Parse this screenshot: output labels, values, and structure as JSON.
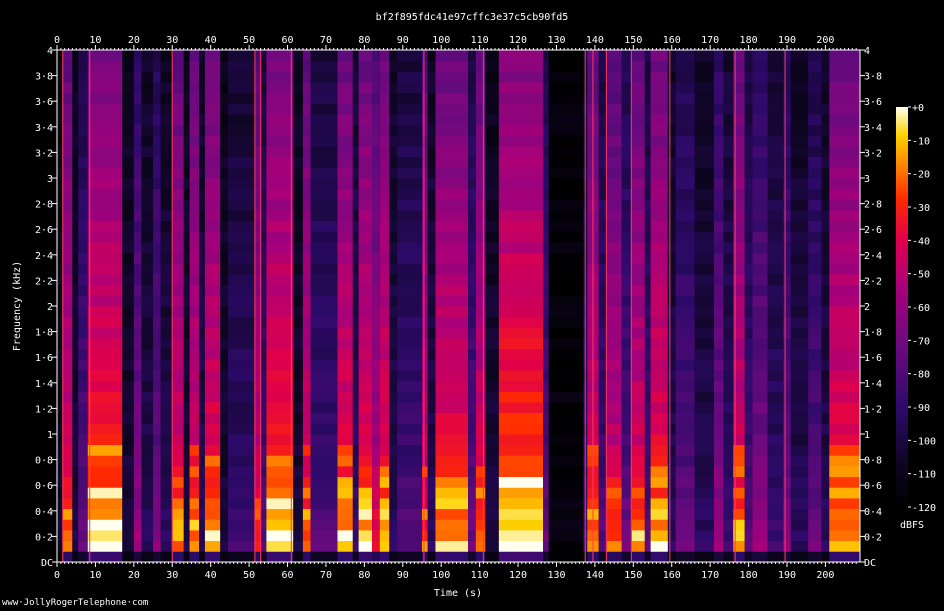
{
  "chart_data": {
    "type": "heatmap",
    "title": "bf2f895fdc41e97cffc3e37c5cb90fd5",
    "xlabel": "Time (s)",
    "ylabel": "Frequency (kHz)",
    "x_ticks": [
      "0",
      "10",
      "20",
      "30",
      "40",
      "50",
      "60",
      "70",
      "80",
      "90",
      "100",
      "110",
      "120",
      "130",
      "140",
      "150",
      "160",
      "170",
      "180",
      "190",
      "200"
    ],
    "y_ticks": [
      "DC",
      "0·2",
      "0·4",
      "0·6",
      "0·8",
      "1",
      "1·2",
      "1·4",
      "1·6",
      "1·8",
      "2",
      "2·2",
      "2·4",
      "2·6",
      "2·8",
      "3",
      "3·2",
      "3·4",
      "3·6",
      "3·8",
      "4"
    ],
    "xlim": [
      0,
      209
    ],
    "ylim": [
      0,
      4
    ],
    "colorbar": {
      "label": "dBFS",
      "ticks": [
        "+0",
        "-10",
        "-20",
        "-30",
        "-40",
        "-50",
        "-60",
        "-70",
        "-80",
        "-90",
        "-100",
        "-110",
        "-120"
      ],
      "range": [
        -120,
        0
      ]
    },
    "intensity_profile": [
      {
        "t0": 0,
        "t1": 1.5,
        "level": 0.1
      },
      {
        "t0": 1.5,
        "t1": 4,
        "level": 0.7
      },
      {
        "t0": 4,
        "t1": 5.5,
        "level": 0.15
      },
      {
        "t0": 5.5,
        "t1": 8,
        "level": 0.35
      },
      {
        "t0": 8,
        "t1": 17,
        "level": 0.8
      },
      {
        "t0": 17,
        "t1": 20,
        "level": 0.15
      },
      {
        "t0": 20,
        "t1": 22,
        "level": 0.45
      },
      {
        "t0": 22,
        "t1": 25,
        "level": 0.2
      },
      {
        "t0": 25,
        "t1": 27,
        "level": 0.4
      },
      {
        "t0": 27,
        "t1": 30,
        "level": 0.2
      },
      {
        "t0": 30,
        "t1": 33,
        "level": 0.7
      },
      {
        "t0": 33,
        "t1": 34.5,
        "level": 0.15
      },
      {
        "t0": 34.5,
        "t1": 37,
        "level": 0.7
      },
      {
        "t0": 37,
        "t1": 38.5,
        "level": 0.2
      },
      {
        "t0": 38.5,
        "t1": 42.5,
        "level": 0.75
      },
      {
        "t0": 42.5,
        "t1": 44.5,
        "level": 0.15
      },
      {
        "t0": 44.5,
        "t1": 51.5,
        "level": 0.25
      },
      {
        "t0": 51.5,
        "t1": 53,
        "level": 0.65
      },
      {
        "t0": 53,
        "t1": 54.5,
        "level": 0.3
      },
      {
        "t0": 54.5,
        "t1": 61.5,
        "level": 0.8
      },
      {
        "t0": 61.5,
        "t1": 64,
        "level": 0.15
      },
      {
        "t0": 64,
        "t1": 66,
        "level": 0.7
      },
      {
        "t0": 66,
        "t1": 73,
        "level": 0.3
      },
      {
        "t0": 73,
        "t1": 77,
        "level": 0.75
      },
      {
        "t0": 77,
        "t1": 78.5,
        "level": 0.25
      },
      {
        "t0": 78.5,
        "t1": 82,
        "level": 0.75
      },
      {
        "t0": 82,
        "t1": 84,
        "level": 0.6
      },
      {
        "t0": 84,
        "t1": 86.5,
        "level": 0.75
      },
      {
        "t0": 86.5,
        "t1": 88.5,
        "level": 0.2
      },
      {
        "t0": 88.5,
        "t1": 95,
        "level": 0.3
      },
      {
        "t0": 95,
        "t1": 96.5,
        "level": 0.65
      },
      {
        "t0": 96.5,
        "t1": 98.5,
        "level": 0.2
      },
      {
        "t0": 98.5,
        "t1": 107,
        "level": 0.75
      },
      {
        "t0": 107,
        "t1": 109,
        "level": 0.35
      },
      {
        "t0": 109,
        "t1": 111.5,
        "level": 0.7
      },
      {
        "t0": 111.5,
        "t1": 115,
        "level": 0.15
      },
      {
        "t0": 115,
        "t1": 126.5,
        "level": 0.85
      },
      {
        "t0": 126.5,
        "t1": 128,
        "level": 0.35
      },
      {
        "t0": 128,
        "t1": 137,
        "level": 0.04
      },
      {
        "t0": 137,
        "t1": 138,
        "level": 0.25
      },
      {
        "t0": 138,
        "t1": 141,
        "level": 0.7
      },
      {
        "t0": 141,
        "t1": 143,
        "level": 0.3
      },
      {
        "t0": 143,
        "t1": 147,
        "level": 0.65
      },
      {
        "t0": 147,
        "t1": 149.5,
        "level": 0.35
      },
      {
        "t0": 149.5,
        "t1": 153,
        "level": 0.7
      },
      {
        "t0": 153,
        "t1": 154.5,
        "level": 0.3
      },
      {
        "t0": 154.5,
        "t1": 159,
        "level": 0.75
      },
      {
        "t0": 159,
        "t1": 161,
        "level": 0.2
      },
      {
        "t0": 161,
        "t1": 166,
        "level": 0.35
      },
      {
        "t0": 166,
        "t1": 171,
        "level": 0.2
      },
      {
        "t0": 171,
        "t1": 173.5,
        "level": 0.45
      },
      {
        "t0": 173.5,
        "t1": 176,
        "level": 0.25
      },
      {
        "t0": 176,
        "t1": 179,
        "level": 0.7
      },
      {
        "t0": 179,
        "t1": 181,
        "level": 0.3
      },
      {
        "t0": 181,
        "t1": 185,
        "level": 0.45
      },
      {
        "t0": 185,
        "t1": 189,
        "level": 0.25
      },
      {
        "t0": 189,
        "t1": 191,
        "level": 0.4
      },
      {
        "t0": 191,
        "t1": 195.5,
        "level": 0.2
      },
      {
        "t0": 195.5,
        "t1": 199,
        "level": 0.35
      },
      {
        "t0": 199,
        "t1": 201,
        "level": 0.2
      },
      {
        "t0": 201,
        "t1": 209,
        "level": 0.75
      }
    ],
    "bright_lines": [
      1.5,
      8.5,
      30,
      51.5,
      53,
      61,
      95.5,
      111,
      137.5,
      139.5,
      143,
      149.5,
      159.5,
      176.5,
      189.5
    ]
  },
  "footer": {
    "watermark": "www·JollyRogerTelephone·com"
  }
}
